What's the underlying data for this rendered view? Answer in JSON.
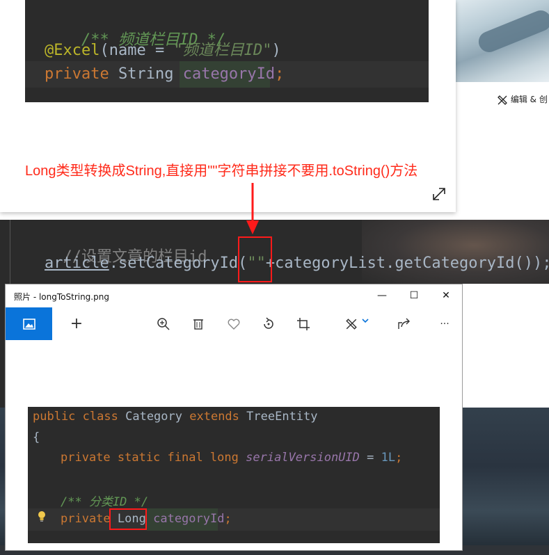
{
  "top_snippet": {
    "comment": "/** 频道栏目ID */",
    "annotation_name": "@Excel",
    "annotation_args_open": "(name = ",
    "annotation_value": "\"频道栏目ID\"",
    "annotation_args_close": ")",
    "keyword": "private",
    "type": "String",
    "field": "categoryId",
    "semicolon": ";"
  },
  "edit_button": {
    "label": "编辑 & 创"
  },
  "annotation_note": "Long类型转换成String,直接用\"\"字符串拼接不要用.toString()方法",
  "middle_snippet": {
    "comment": "//设置文章的栏目id",
    "object": "article",
    "call_open": ".setCategoryId(",
    "empty_string": "\"\"",
    "rest": "+categoryList.getCategoryId());"
  },
  "photos_window": {
    "title": "照片 - longToString.png",
    "minimize": "—",
    "maximize": "☐",
    "close": "✕",
    "toolbar": {
      "add": "+",
      "more": "···"
    },
    "code": {
      "line1_kw1": "public",
      "line1_kw2": "class",
      "line1_name": "Category",
      "line1_kw3": "extends",
      "line1_parent": "TreeEntity",
      "line2": "{",
      "line3_mods": "private static final long",
      "line3_field": "serialVersionUID",
      "line3_eq": " = ",
      "line3_val": "1L",
      "line3_semi": ";",
      "line4_comment": "/** 分类ID */",
      "line5_kw": "private",
      "line5_type": "Long",
      "line5_field": "categoryId",
      "line5_semi": ";"
    }
  },
  "colors": {
    "annotation_red": "#ff2a1a",
    "photos_accent": "#0a74da",
    "code_bg": "#2b2b2b"
  }
}
